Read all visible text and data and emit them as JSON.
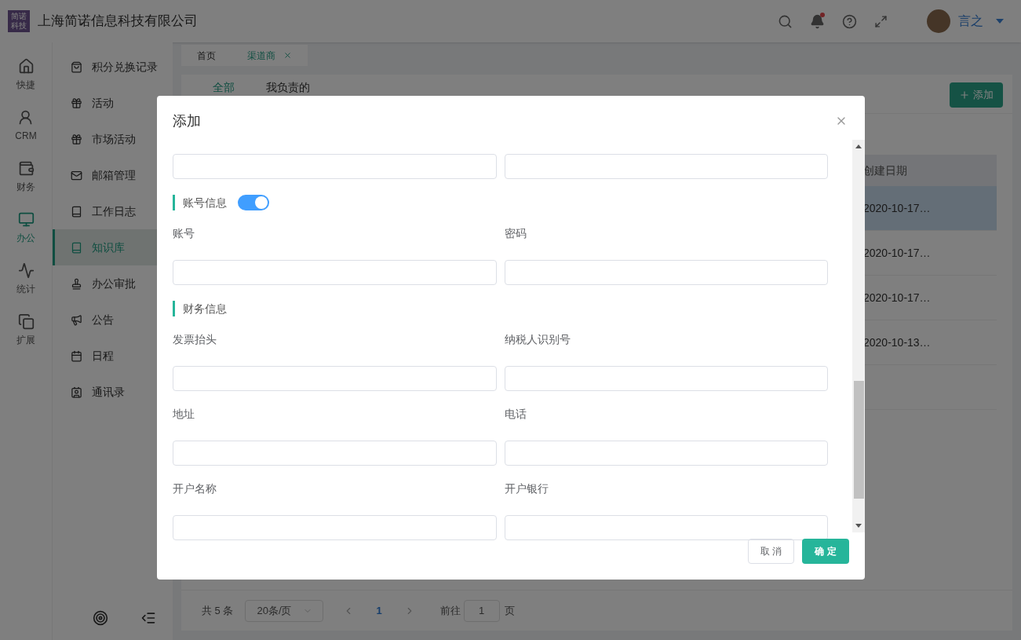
{
  "header": {
    "logo": "简诺科技",
    "company": "上海简诺信息科技有限公司",
    "user": "言之",
    "has_notification": true
  },
  "rail": [
    {
      "label": "快捷",
      "selected": false
    },
    {
      "label": "CRM",
      "selected": false
    },
    {
      "label": "财务",
      "selected": false
    },
    {
      "label": "办公",
      "selected": true
    },
    {
      "label": "统计",
      "selected": false
    },
    {
      "label": "扩展",
      "selected": false
    }
  ],
  "submenu": [
    {
      "label": "积分兑换记录",
      "selected": false
    },
    {
      "label": "活动",
      "selected": false
    },
    {
      "label": "市场活动",
      "selected": false
    },
    {
      "label": "邮箱管理",
      "selected": false
    },
    {
      "label": "工作日志",
      "selected": false
    },
    {
      "label": "知识库",
      "selected": true
    },
    {
      "label": "办公审批",
      "selected": false
    },
    {
      "label": "公告",
      "selected": false
    },
    {
      "label": "日程",
      "selected": false
    },
    {
      "label": "通讯录",
      "selected": false
    }
  ],
  "page_tabs": [
    {
      "label": "首页",
      "selected": false
    },
    {
      "label": "渠道商",
      "selected": true
    }
  ],
  "filter_tabs": [
    {
      "label": "全部",
      "selected": true
    },
    {
      "label": "我负责的",
      "selected": false
    }
  ],
  "add_button": "添加",
  "table": {
    "columns": [
      "创建日期"
    ],
    "rows": [
      {
        "date": "2020-10-17…",
        "selected": true
      },
      {
        "date": "2020-10-17…",
        "selected": false
      },
      {
        "date": "2020-10-17…",
        "selected": false
      },
      {
        "date": "2020-10-13…",
        "selected": false
      },
      {
        "selected": false
      }
    ]
  },
  "pagination": {
    "total": "共 5 条",
    "page_size": "20条/页",
    "current": "1",
    "goto_label": "前往",
    "goto_value": "1",
    "page_unit": "页"
  },
  "dialog": {
    "title": "添加",
    "blocks": [
      {
        "kind": "inputs"
      },
      {
        "kind": "section",
        "title": "账号信息",
        "toggle": true
      },
      {
        "kind": "fields",
        "fields": [
          {
            "label": "账号"
          },
          {
            "label": "密码"
          }
        ]
      },
      {
        "kind": "section",
        "title": "财务信息"
      },
      {
        "kind": "fields",
        "fields": [
          {
            "label": "发票抬头"
          },
          {
            "label": "纳税人识别号"
          }
        ]
      },
      {
        "kind": "fields",
        "fields": [
          {
            "label": "地址"
          },
          {
            "label": "电话"
          }
        ]
      },
      {
        "kind": "fields",
        "fields": [
          {
            "label": "开户名称"
          },
          {
            "label": "开户银行"
          }
        ]
      }
    ],
    "cancel": "取 消",
    "confirm": "确 定"
  }
}
